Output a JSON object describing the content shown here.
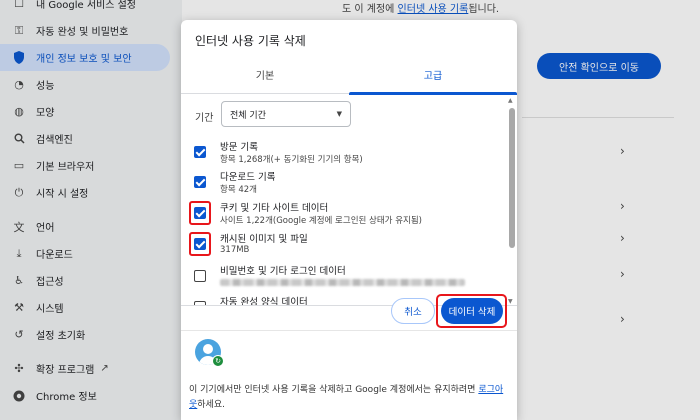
{
  "sidebar": {
    "items": [
      {
        "label": "내 Google 서비스 설정",
        "icon": "google-services-icon"
      },
      {
        "label": "자동 완성 및 비밀번호",
        "icon": "key-icon"
      },
      {
        "label": "개인 정보 보호 및 보안",
        "icon": "shield-icon",
        "active": true
      },
      {
        "label": "성능",
        "icon": "speedometer-icon"
      },
      {
        "label": "모양",
        "icon": "palette-icon"
      },
      {
        "label": "검색엔진",
        "icon": "search-icon"
      },
      {
        "label": "기본 브라우저",
        "icon": "browser-icon"
      },
      {
        "label": "시작 시 설정",
        "icon": "power-icon"
      },
      {
        "label": "언어",
        "icon": "translate-icon"
      },
      {
        "label": "다운로드",
        "icon": "download-icon"
      },
      {
        "label": "접근성",
        "icon": "accessibility-icon"
      },
      {
        "label": "시스템",
        "icon": "wrench-icon"
      },
      {
        "label": "설정 초기화",
        "icon": "reset-icon"
      },
      {
        "label": "확장 프로그램",
        "icon": "puzzle-icon"
      },
      {
        "label": "Chrome 정보",
        "icon": "chrome-icon"
      }
    ]
  },
  "background": {
    "top_text_before": "도 이 계정에",
    "top_link": "인터넷 사용 기록",
    "top_text_after": "됩니다.",
    "safety_button": "안전 확인으로 이동"
  },
  "dialog": {
    "title": "인터넷 사용 기록 삭제",
    "tabs": [
      {
        "label": "기본",
        "selected": false
      },
      {
        "label": "고급",
        "selected": true
      }
    ],
    "range_label": "기간",
    "range_value": "전체 기간",
    "items": [
      {
        "title": "방문 기록",
        "sub": "항목 1,268개(+ 동기화된 기기의 항목)",
        "checked": true,
        "highlighted": false
      },
      {
        "title": "다운로드 기록",
        "sub": "항목 42개",
        "checked": true,
        "highlighted": false
      },
      {
        "title": "쿠키 및 기타 사이트 데이터",
        "sub": "사이트 1,22개(Google 계정에 로그인된 상태가 유지됨)",
        "checked": true,
        "highlighted": true
      },
      {
        "title": "캐시된 이미지 및 파일",
        "sub": "317MB",
        "checked": true,
        "highlighted": true
      },
      {
        "title": "비밀번호 및 기타 로그인 데이터",
        "sub": "",
        "checked": false,
        "highlighted": false
      },
      {
        "title": "자동 완성 양식 데이터",
        "sub": "",
        "checked": false,
        "highlighted": false
      }
    ],
    "cancel_label": "취소",
    "delete_label": "데이터 삭제",
    "footer_text": "이 기기에서만 인터넷 사용 기록을 삭제하고 Google 계정에서는 유지하려면",
    "footer_link_1": "로그아",
    "footer_link_2": "웃",
    "footer_end": "하세요."
  },
  "colors": {
    "accent": "#0b57d0",
    "highlight": "#e8161b",
    "sync_badge": "#1e8e3e"
  }
}
